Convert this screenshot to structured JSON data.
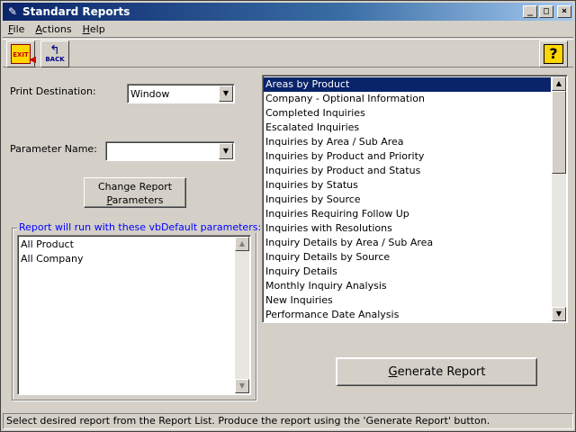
{
  "window": {
    "title": "Standard Reports"
  },
  "title_buttons": {
    "minimize": "_",
    "maximize": "□",
    "close": "×"
  },
  "menu": [
    {
      "label": "File",
      "accel": "F",
      "rest": "ile"
    },
    {
      "label": "Actions",
      "accel": "A",
      "rest": "ctions"
    },
    {
      "label": "Help",
      "accel": "H",
      "rest": "elp"
    }
  ],
  "toolbar": {
    "exit_label": "EXIT",
    "back_label": "BACK",
    "help_glyph": "?"
  },
  "form": {
    "print_destination_label": "Print Destination:",
    "print_destination_value": "Window",
    "parameter_name_label": "Parameter Name:",
    "parameter_name_value": "",
    "change_button_line1": "Change Report",
    "change_button_accel": "P",
    "change_button_line2_rest": "arameters"
  },
  "parameters_group": {
    "legend": "Report will run with these vbDefault parameters:",
    "items": [
      "All Product",
      "All Company"
    ]
  },
  "report_list": {
    "selected_index": 0,
    "items": [
      "Areas by Product",
      "Company - Optional Information",
      "Completed Inquiries",
      "Escalated Inquiries",
      "Inquiries by Area / Sub Area",
      "Inquiries by Product and Priority",
      "Inquiries by Product and Status",
      "Inquiries by Status",
      "Inquiries by Source",
      "Inquiries Requiring Follow Up",
      "Inquiries with Resolutions",
      "Inquiry Details by Area / Sub Area",
      "Inquiry Details by Source",
      "Inquiry Details",
      "Monthly Inquiry Analysis",
      "New Inquiries",
      "Performance Date Analysis"
    ]
  },
  "generate_button": {
    "accel": "G",
    "rest": "enerate Report"
  },
  "status": {
    "text": "Select desired report from the Report List.  Produce the report using the 'Generate Report' button."
  }
}
